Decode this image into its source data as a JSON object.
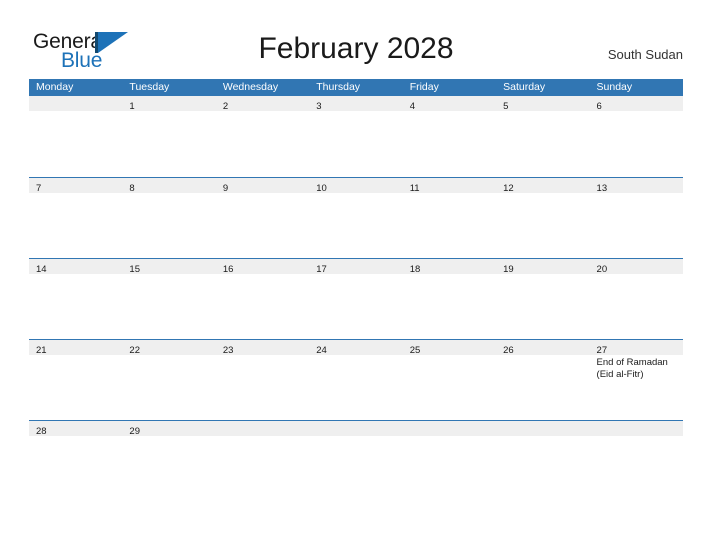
{
  "brand": {
    "name_part1": "General",
    "name_part2": "Blue",
    "logo_icon": "flag-triangle-icon",
    "accent_color": "#1d72b8"
  },
  "header": {
    "title": "February 2028",
    "country": "South Sudan"
  },
  "colors": {
    "header_blue": "#3176b3",
    "date_band_gray": "#efefef",
    "text": "#1a1a1a"
  },
  "calendar": {
    "weekdays": [
      "Monday",
      "Tuesday",
      "Wednesday",
      "Thursday",
      "Friday",
      "Saturday",
      "Sunday"
    ],
    "weeks": [
      [
        {
          "num": "",
          "events": []
        },
        {
          "num": "1",
          "events": []
        },
        {
          "num": "2",
          "events": []
        },
        {
          "num": "3",
          "events": []
        },
        {
          "num": "4",
          "events": []
        },
        {
          "num": "5",
          "events": []
        },
        {
          "num": "6",
          "events": []
        }
      ],
      [
        {
          "num": "7",
          "events": []
        },
        {
          "num": "8",
          "events": []
        },
        {
          "num": "9",
          "events": []
        },
        {
          "num": "10",
          "events": []
        },
        {
          "num": "11",
          "events": []
        },
        {
          "num": "12",
          "events": []
        },
        {
          "num": "13",
          "events": []
        }
      ],
      [
        {
          "num": "14",
          "events": []
        },
        {
          "num": "15",
          "events": []
        },
        {
          "num": "16",
          "events": []
        },
        {
          "num": "17",
          "events": []
        },
        {
          "num": "18",
          "events": []
        },
        {
          "num": "19",
          "events": []
        },
        {
          "num": "20",
          "events": []
        }
      ],
      [
        {
          "num": "21",
          "events": []
        },
        {
          "num": "22",
          "events": []
        },
        {
          "num": "23",
          "events": []
        },
        {
          "num": "24",
          "events": []
        },
        {
          "num": "25",
          "events": []
        },
        {
          "num": "26",
          "events": []
        },
        {
          "num": "27",
          "events": [
            "End of Ramadan",
            "(Eid al-Fitr)"
          ]
        }
      ],
      [
        {
          "num": "28",
          "events": []
        },
        {
          "num": "29",
          "events": []
        },
        {
          "num": "",
          "events": []
        },
        {
          "num": "",
          "events": []
        },
        {
          "num": "",
          "events": []
        },
        {
          "num": "",
          "events": []
        },
        {
          "num": "",
          "events": []
        }
      ]
    ]
  }
}
